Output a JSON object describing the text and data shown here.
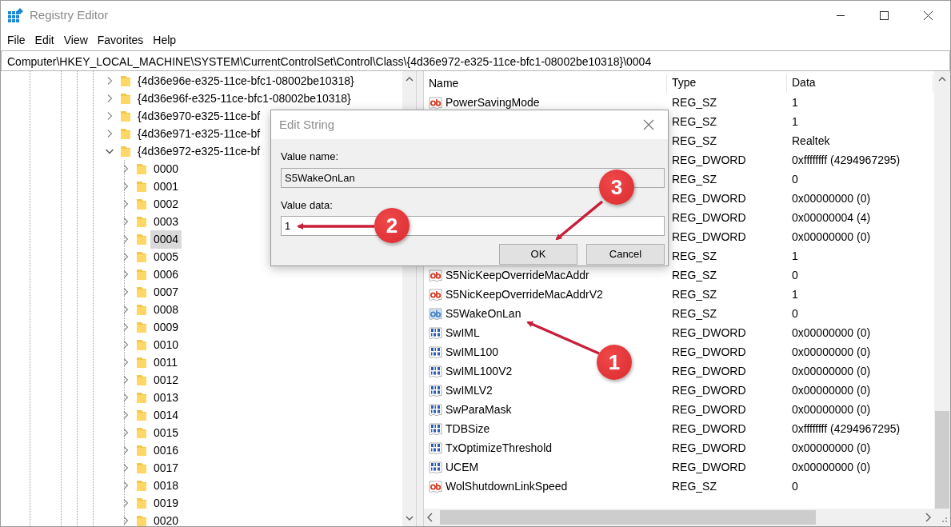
{
  "window": {
    "title": "Registry Editor"
  },
  "menu": [
    "File",
    "Edit",
    "View",
    "Favorites",
    "Help"
  ],
  "address": "Computer\\HKEY_LOCAL_MACHINE\\SYSTEM\\CurrentControlSet\\Control\\Class\\{4d36e972-e325-11ce-bfc1-08002be10318}\\0004",
  "tree": {
    "items": [
      {
        "label": "{4d36e96e-e325-11ce-bfc1-08002be10318}",
        "expanded": false,
        "selected": false
      },
      {
        "label": "{4d36e96f-e325-11ce-bfc1-08002be10318}",
        "expanded": false,
        "selected": false
      },
      {
        "label": "{4d36e970-e325-11ce-bf",
        "expanded": false,
        "selected": false
      },
      {
        "label": "{4d36e971-e325-11ce-bf",
        "expanded": false,
        "selected": false
      },
      {
        "label": "{4d36e972-e325-11ce-bf",
        "expanded": true,
        "selected": false,
        "children": [
          {
            "label": "0000",
            "expanded": false,
            "selected": false
          },
          {
            "label": "0001",
            "expanded": false,
            "selected": false
          },
          {
            "label": "0002",
            "expanded": false,
            "selected": false
          },
          {
            "label": "0003",
            "expanded": false,
            "selected": false
          },
          {
            "label": "0004",
            "expanded": false,
            "selected": true
          },
          {
            "label": "0005",
            "expanded": false,
            "selected": false
          },
          {
            "label": "0006",
            "expanded": false,
            "selected": false
          },
          {
            "label": "0007",
            "expanded": false,
            "selected": false
          },
          {
            "label": "0008",
            "expanded": false,
            "selected": false
          },
          {
            "label": "0009",
            "expanded": false,
            "selected": false
          },
          {
            "label": "0010",
            "expanded": false,
            "selected": false
          },
          {
            "label": "0011",
            "expanded": false,
            "selected": false
          },
          {
            "label": "0012",
            "expanded": false,
            "selected": false
          },
          {
            "label": "0013",
            "expanded": false,
            "selected": false
          },
          {
            "label": "0014",
            "expanded": false,
            "selected": false
          },
          {
            "label": "0015",
            "expanded": false,
            "selected": false
          },
          {
            "label": "0016",
            "expanded": false,
            "selected": false
          },
          {
            "label": "0017",
            "expanded": false,
            "selected": false
          },
          {
            "label": "0018",
            "expanded": false,
            "selected": false
          },
          {
            "label": "0019",
            "expanded": false,
            "selected": false
          },
          {
            "label": "0020",
            "expanded": false,
            "selected": false
          }
        ]
      }
    ]
  },
  "values": {
    "columns": [
      "Name",
      "Type",
      "Data"
    ],
    "rows": [
      {
        "kind": "string",
        "name": "PowerSavingMode",
        "type": "REG_SZ",
        "data": "1",
        "selected": false
      },
      {
        "type": "REG_SZ",
        "data": "1"
      },
      {
        "type": "REG_SZ",
        "data": "Realtek"
      },
      {
        "type": "REG_DWORD",
        "data": "0xffffffff (4294967295)"
      },
      {
        "type": "REG_SZ",
        "data": "0"
      },
      {
        "type": "REG_DWORD",
        "data": "0x00000000 (0)"
      },
      {
        "type": "REG_DWORD",
        "data": "0x00000004 (4)"
      },
      {
        "type": "REG_DWORD",
        "data": "0x00000000 (0)"
      },
      {
        "type": "REG_SZ",
        "data": "1"
      },
      {
        "kind": "string",
        "name": "S5NicKeepOverrideMacAddr",
        "type": "REG_SZ",
        "data": "0",
        "selected": false
      },
      {
        "kind": "string",
        "name": "S5NicKeepOverrideMacAddrV2",
        "type": "REG_SZ",
        "data": "1",
        "selected": false
      },
      {
        "kind": "string",
        "name": "S5WakeOnLan",
        "type": "REG_SZ",
        "data": "0",
        "selected": true
      },
      {
        "kind": "dword",
        "name": "SwIML",
        "type": "REG_DWORD",
        "data": "0x00000000 (0)",
        "selected": false
      },
      {
        "kind": "dword",
        "name": "SwIML100",
        "type": "REG_DWORD",
        "data": "0x00000000 (0)",
        "selected": false
      },
      {
        "kind": "dword",
        "name": "SwIML100V2",
        "type": "REG_DWORD",
        "data": "0x00000000 (0)",
        "selected": false
      },
      {
        "kind": "dword",
        "name": "SwIMLV2",
        "type": "REG_DWORD",
        "data": "0x00000000 (0)",
        "selected": false
      },
      {
        "kind": "dword",
        "name": "SwParaMask",
        "type": "REG_DWORD",
        "data": "0x00000000 (0)",
        "selected": false
      },
      {
        "kind": "dword",
        "name": "TDBSize",
        "type": "REG_DWORD",
        "data": "0xffffffff (4294967295)",
        "selected": false
      },
      {
        "kind": "dword",
        "name": "TxOptimizeThreshold",
        "type": "REG_DWORD",
        "data": "0x00000000 (0)",
        "selected": false
      },
      {
        "kind": "dword",
        "name": "UCEM",
        "type": "REG_DWORD",
        "data": "0x00000000 (0)",
        "selected": false
      },
      {
        "kind": "string",
        "name": "WolShutdownLinkSpeed",
        "type": "REG_SZ",
        "data": "0",
        "selected": false
      }
    ]
  },
  "dialog": {
    "title": "Edit String",
    "name_label": "Value name:",
    "name_value": "S5WakeOnLan",
    "data_label": "Value data:",
    "data_value": "1",
    "buttons": [
      "OK",
      "Cancel"
    ]
  },
  "annotations": [
    {
      "label": "1"
    },
    {
      "label": "2"
    },
    {
      "label": "3"
    }
  ]
}
